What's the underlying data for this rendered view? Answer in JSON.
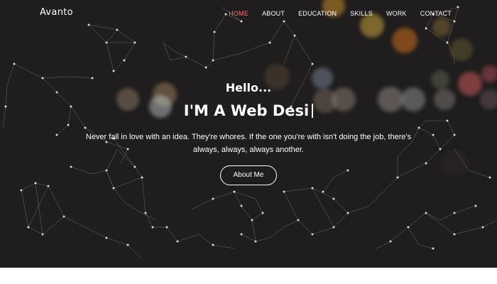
{
  "brand": "Avanto",
  "nav": {
    "items": [
      {
        "label": "HOME",
        "active": true
      },
      {
        "label": "ABOUT",
        "active": false
      },
      {
        "label": "EDUCATION",
        "active": false
      },
      {
        "label": "SKILLS",
        "active": false
      },
      {
        "label": "WORK",
        "active": false
      },
      {
        "label": "CONTACT",
        "active": false
      }
    ]
  },
  "hero": {
    "greeting": "Hello...",
    "headline": "I'M  A Web Desi",
    "tagline": "Never fall in love with an idea. They're whores. If the one you're with isn't doing the job, there's always, always, always another.",
    "cta_label": "About Me"
  },
  "colors": {
    "hero_background": "#1f1d1d",
    "active_nav": "#ff6b6b",
    "text": "#ffffff"
  }
}
